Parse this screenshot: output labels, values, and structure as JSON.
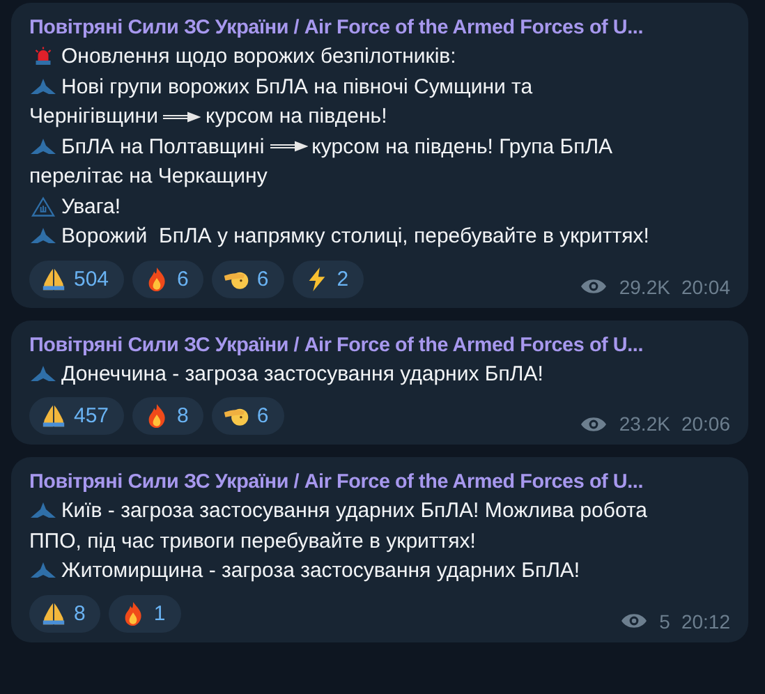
{
  "messages": [
    {
      "channel": "Повітряні Сили ЗС України / Air Force of the Armed Forces of U...",
      "lines": [
        {
          "kind": "siren",
          "rows": [
            [
              "Оновлення щодо ворожих безпілотників:"
            ]
          ]
        },
        {
          "kind": "drone",
          "rows": [
            [
              "Нові групи ворожих БпЛА на півночі Сумщини та"
            ],
            [
              "Чернігівщини",
              "курсом на південь!"
            ]
          ]
        },
        {
          "kind": "drone",
          "rows": [
            [
              "БпЛА на Полтавщині",
              "курсом на південь! Група БпЛА"
            ],
            [
              "перелітає на Черкащину"
            ]
          ]
        },
        {
          "kind": "warning",
          "rows": [
            [
              "Увага!"
            ]
          ]
        },
        {
          "kind": "drone",
          "rows": [
            [
              "Ворожий  БпЛА у напрямку столиці, перебувайте в укриттях!"
            ]
          ]
        }
      ],
      "reactions": [
        {
          "kind": "pray",
          "count": "504"
        },
        {
          "kind": "fire",
          "count": "6"
        },
        {
          "kind": "salute",
          "count": "6"
        },
        {
          "kind": "zap",
          "count": "2"
        }
      ],
      "views": "29.2K",
      "time": "20:04"
    },
    {
      "channel": "Повітряні Сили ЗС України / Air Force of the Armed Forces of U...",
      "lines": [
        {
          "kind": "drone",
          "rows": [
            [
              "Донеччина - загроза застосування ударних БпЛА!"
            ]
          ]
        }
      ],
      "reactions": [
        {
          "kind": "pray",
          "count": "457"
        },
        {
          "kind": "fire",
          "count": "8"
        },
        {
          "kind": "salute",
          "count": "6"
        }
      ],
      "views": "23.2K",
      "time": "20:06"
    },
    {
      "channel": "Повітряні Сили ЗС України / Air Force of the Armed Forces of U...",
      "lines": [
        {
          "kind": "drone",
          "rows": [
            [
              "Київ - загроза застосування ударних БпЛА! Можлива робота"
            ],
            [
              "ППО, під час тривоги перебувайте в укриттях!"
            ]
          ]
        },
        {
          "kind": "drone",
          "rows": [
            [
              "Житомирщина - загроза застосування ударних БпЛА!"
            ]
          ]
        }
      ],
      "reactions": [
        {
          "kind": "pray",
          "count": "8"
        },
        {
          "kind": "fire",
          "count": "1"
        }
      ],
      "views": "5",
      "time": "20:12"
    }
  ]
}
